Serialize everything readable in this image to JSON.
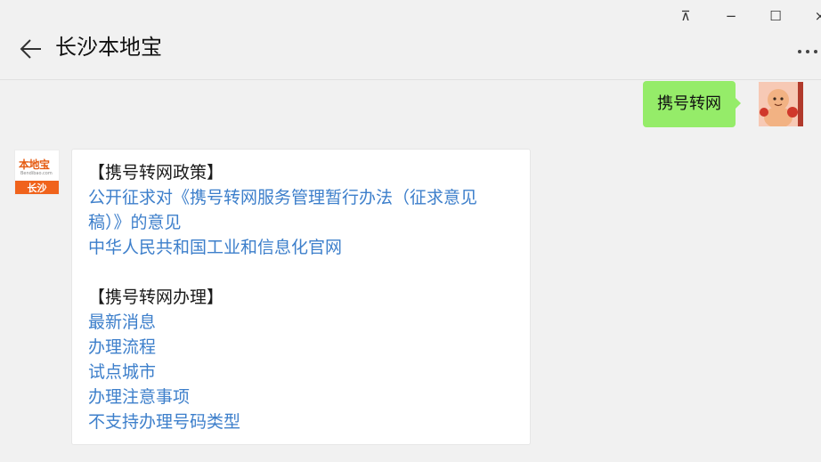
{
  "window": {
    "pin_glyph": "⊼",
    "minimize_glyph": "−",
    "maximize_glyph": "☐",
    "close_glyph": "×"
  },
  "header": {
    "title": "长沙本地宝",
    "back_icon": "arrow-left-icon",
    "more_icon": "more-dots-icon"
  },
  "messages": {
    "outgoing": {
      "text": "携号转网",
      "bubble_color": "#95ec69"
    },
    "incoming": {
      "avatar": {
        "logo_text": "本地宝",
        "logo_sub": "Bendibao.com",
        "city": "长沙",
        "brand_color": "#f0631c"
      },
      "section1_title": "【携号转网政策】",
      "section1_links": [
        "公开征求对《携号转网服务管理暂行办法（征求意见",
        "稿）》的意见",
        "中华人民共和国工业和信息化官网"
      ],
      "section2_title": "【携号转网办理】",
      "section2_links": [
        "最新消息",
        "办理流程",
        "试点城市",
        "办理注意事项",
        "不支持办理号码类型"
      ],
      "link_color": "#3d7fcb"
    }
  }
}
